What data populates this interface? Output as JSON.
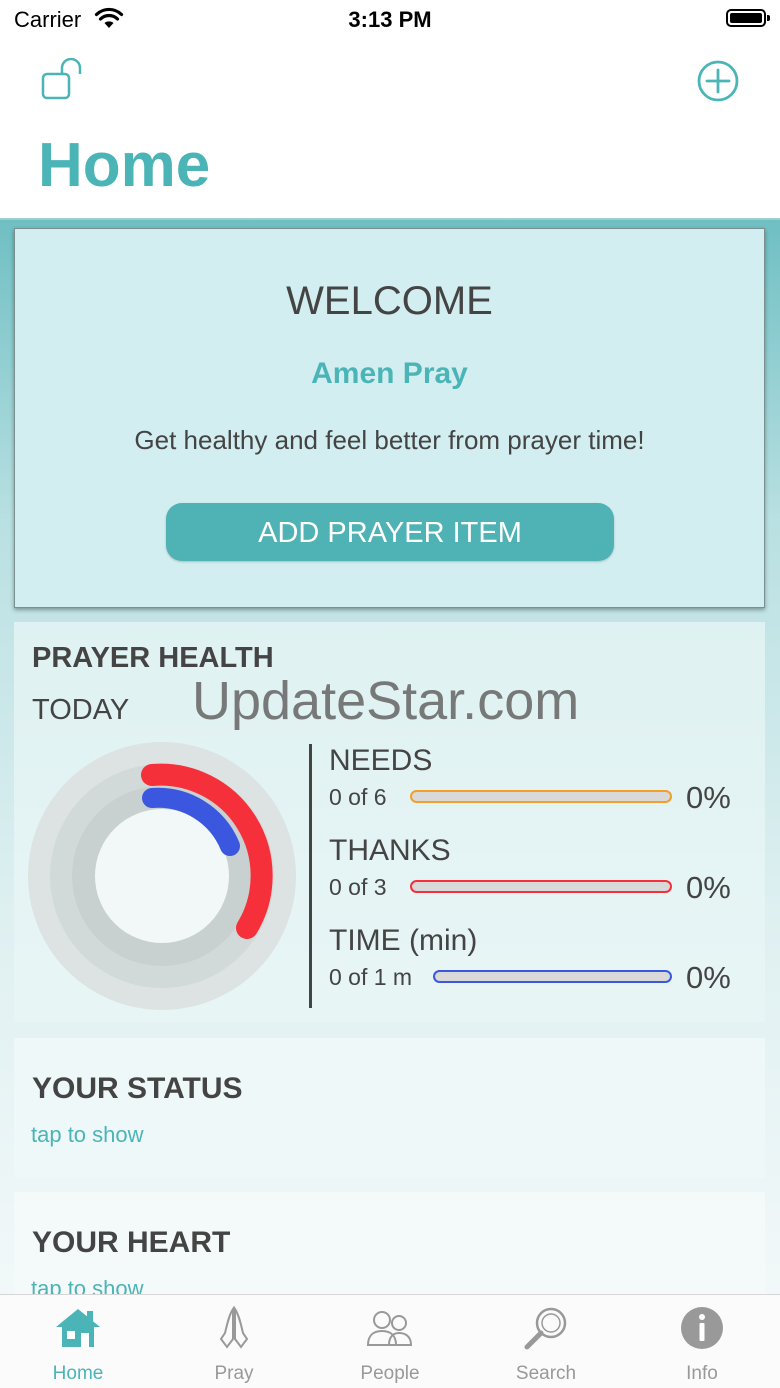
{
  "status_bar": {
    "carrier": "Carrier",
    "time": "3:13 PM"
  },
  "nav": {
    "title": "Home",
    "lock_icon": "unlock-icon",
    "add_icon": "plus-circle-icon"
  },
  "welcome": {
    "heading": "WELCOME",
    "app_name": "Amen Pray",
    "tagline": "Get healthy and feel better from prayer time!",
    "button_label": "ADD PRAYER ITEM"
  },
  "prayer_health": {
    "title": "PRAYER HEALTH",
    "period": "TODAY",
    "watermark": "UpdateStar.com",
    "metrics": [
      {
        "label": "NEEDS",
        "count": "0 of 6",
        "percent": "0%",
        "value": 0,
        "color": "#f2a02a"
      },
      {
        "label": "THANKS",
        "count": "0 of 3",
        "percent": "0%",
        "value": 0,
        "color": "#f5303b"
      },
      {
        "label": "TIME (min)",
        "count": "0 of 1 m",
        "percent": "0%",
        "value": 0,
        "color": "#3b57e0"
      }
    ]
  },
  "status_section": {
    "heading": "YOUR STATUS",
    "link": "tap to show"
  },
  "heart_section": {
    "heading": "YOUR HEART",
    "link": "tap to show"
  },
  "tabs": [
    {
      "label": "Home",
      "icon": "house-icon",
      "active": true
    },
    {
      "label": "Pray",
      "icon": "praying-hands-icon",
      "active": false
    },
    {
      "label": "People",
      "icon": "people-icon",
      "active": false
    },
    {
      "label": "Search",
      "icon": "magnifier-icon",
      "active": false
    },
    {
      "label": "Info",
      "icon": "info-icon",
      "active": false
    }
  ],
  "colors": {
    "accent": "#4bb4b6",
    "needs": "#f2a02a",
    "thanks": "#f5303b",
    "time": "#3b57e0"
  }
}
